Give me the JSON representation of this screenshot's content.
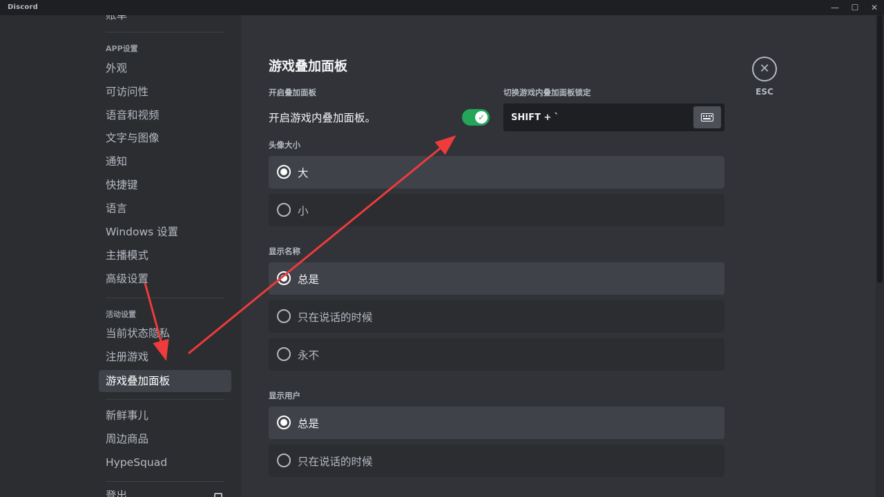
{
  "titlebar": {
    "app_name": "Discord",
    "minimize": "—",
    "maximize": "☐",
    "close": "✕"
  },
  "sidebar": {
    "top_cut_item": "账单",
    "app_settings_header": "APP设置",
    "app_items": [
      "外观",
      "可访问性",
      "语音和视频",
      "文字与图像",
      "通知",
      "快捷键",
      "语言",
      "Windows 设置",
      "主播模式",
      "高级设置"
    ],
    "activity_header": "活动设置",
    "activity_items": [
      "当前状态隐私",
      "注册游戏",
      "游戏叠加面板"
    ],
    "selected_item": "游戏叠加面板",
    "misc_items": [
      "新鲜事儿",
      "周边商品",
      "HypeSquad"
    ],
    "bottom_cut_item": "登出"
  },
  "overlay": {
    "title": "游戏叠加面板",
    "enable_label": "开启叠加面板",
    "enable_text": "开启游戏内叠加面板。",
    "enabled": true,
    "toggle_check": "✓",
    "lock_label": "切换游戏内叠加面板锁定",
    "lock_combo": "SHIFT + `",
    "avatar_size": {
      "label": "头像大小",
      "options": [
        "大",
        "小"
      ],
      "selected": "大"
    },
    "display_names": {
      "label": "显示名称",
      "options": [
        "总是",
        "只在说话的时候",
        "永不"
      ],
      "selected": "总是"
    },
    "display_users": {
      "label": "显示用户",
      "options": [
        "总是",
        "只在说话的时候"
      ],
      "selected": "总是"
    }
  },
  "close": {
    "icon": "✕",
    "label": "ESC"
  },
  "colors": {
    "accent_green": "#23a55a",
    "annotation_red": "#ee3b3b"
  }
}
